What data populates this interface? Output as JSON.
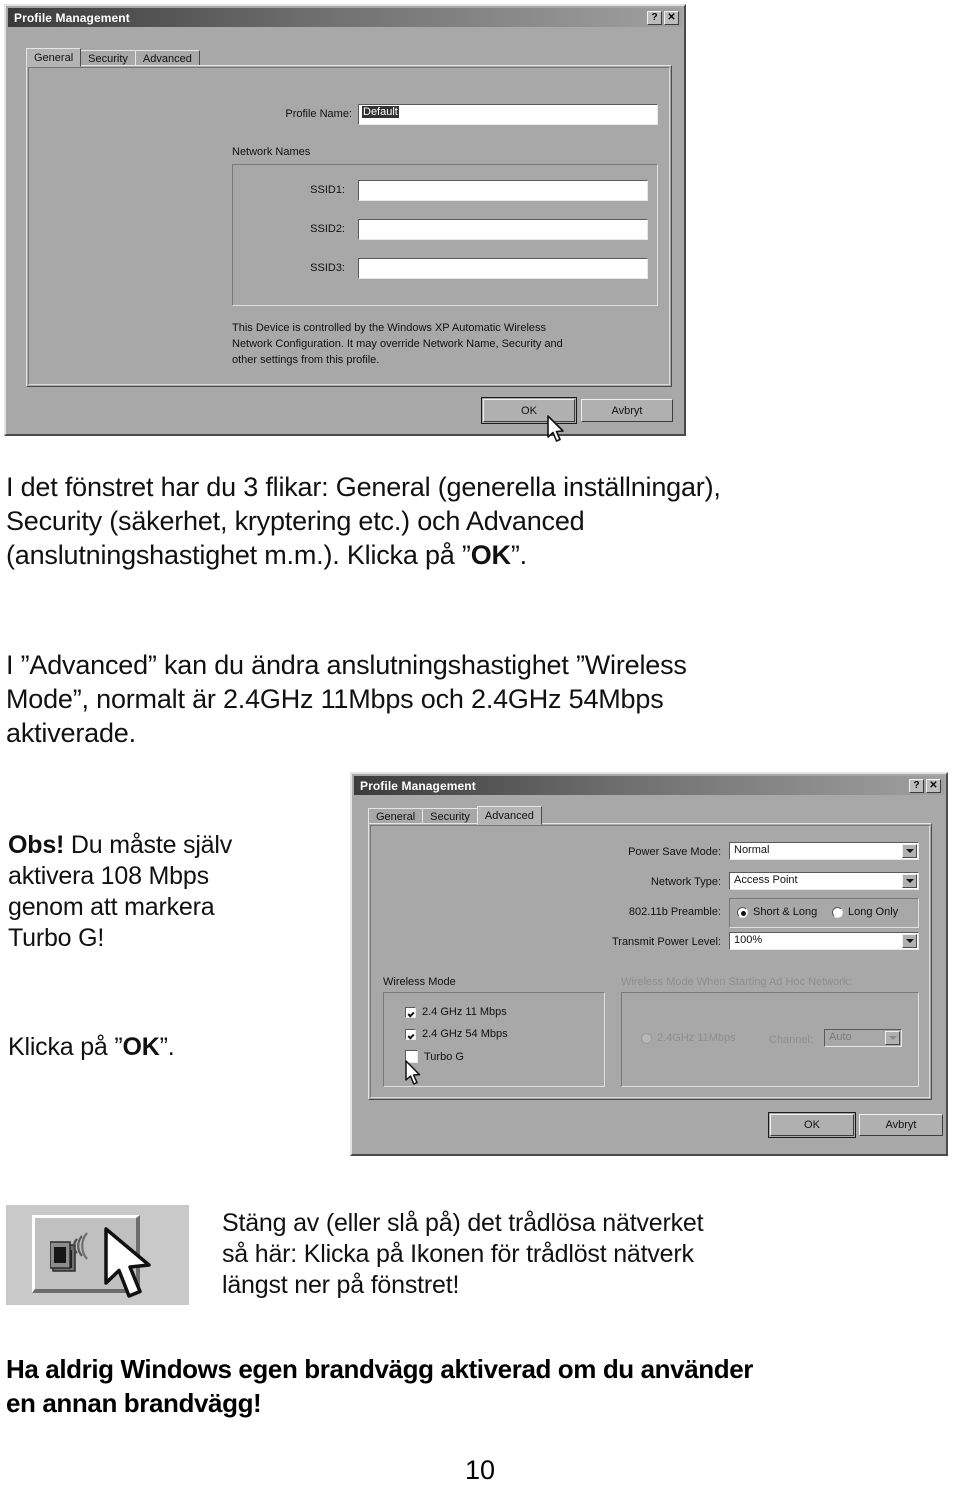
{
  "page": {
    "number": "10"
  },
  "dialog1": {
    "title": "Profile Management",
    "help_btn": "?",
    "close_btn": "✕",
    "tabs": [
      {
        "label": "General",
        "active": true
      },
      {
        "label": "Security",
        "active": false
      },
      {
        "label": "Advanced",
        "active": false
      }
    ],
    "profile_name_label": "Profile Name:",
    "profile_name_value": "Default",
    "network_names_label": "Network Names",
    "ssid": [
      {
        "label": "SSID1:",
        "value": ""
      },
      {
        "label": "SSID2:",
        "value": ""
      },
      {
        "label": "SSID3:",
        "value": ""
      }
    ],
    "info_line1": "This Device is controlled by the Windows XP Automatic Wireless",
    "info_line2": "Network Configuration. It may override Network Name, Security and",
    "info_line3": "other settings from this profile.",
    "ok_label": "OK",
    "cancel_label": "Avbryt"
  },
  "dialog2": {
    "title": "Profile Management",
    "help_btn": "?",
    "close_btn": "✕",
    "tabs": [
      {
        "label": "General",
        "active": false
      },
      {
        "label": "Security",
        "active": false
      },
      {
        "label": "Advanced",
        "active": true
      }
    ],
    "power_save_label": "Power Save Mode:",
    "power_save_value": "Normal",
    "network_type_label": "Network Type:",
    "network_type_value": "Access Point",
    "preamble_label": "802.11b Preamble:",
    "preamble_option1": "Short & Long",
    "preamble_option2": "Long Only",
    "transmit_power_label": "Transmit Power Level:",
    "transmit_power_value": "100%",
    "wireless_mode_label": "Wireless Mode",
    "wireless_modes": [
      {
        "label": "2.4 GHz 11 Mbps",
        "checked": true
      },
      {
        "label": "2.4 GHz 54 Mbps",
        "checked": true
      },
      {
        "label": "Turbo G",
        "checked": false
      }
    ],
    "adhoc_label": "Wireless Mode When Starting Ad Hoc Network:",
    "adhoc_option": "2.4GHz 11Mbps",
    "channel_label": "Channel:",
    "channel_value": "Auto",
    "ok_label": "OK",
    "cancel_label": "Avbryt"
  },
  "body": {
    "p1_l1": "I det fönstret har du 3 flikar: General (generella inställningar),",
    "p1_l2": "Security (säkerhet, kryptering etc.) och Advanced",
    "p1_l3_a": "(anslutningshastighet m.m.). Klicka på ”",
    "p1_l3_b": "OK",
    "p1_l3_c": "”.",
    "p2_l1": "I ”Advanced” kan du ändra anslutningshastighet ”Wireless",
    "p2_l2": "Mode”, normalt är 2.4GHz 11Mbps och 2.4GHz 54Mbps",
    "p2_l3": "aktiverade.",
    "obs_bold": "Obs!",
    "obs_l1": " Du måste själv",
    "obs_l2": "aktivera 108 Mbps",
    "obs_l3": "genom att markera",
    "obs_l4": "Turbo G!",
    "klicka_a": "Klicka på ”",
    "klicka_b": "OK",
    "klicka_c": "”.",
    "p4_l1": "Stäng av (eller slå på) det trådlösa nätverket",
    "p4_l2": "så här: Klicka på Ikonen för trådlöst nätverk",
    "p4_l3": "längst ner på fönstret!",
    "warn_l1": "Ha aldrig Windows egen brandvägg aktiverad om du använder",
    "warn_l2": "en annan brandvägg!"
  }
}
